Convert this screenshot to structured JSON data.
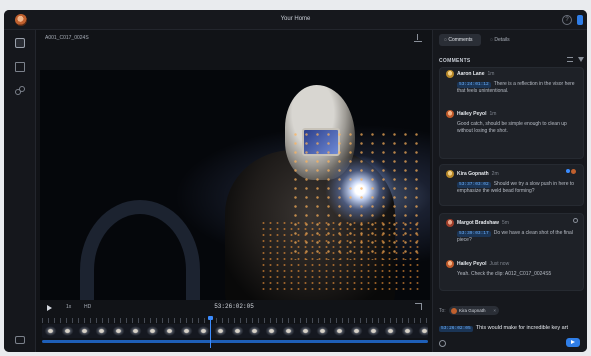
{
  "window": {
    "title": "Your Home"
  },
  "file": {
    "name": "A001_C017_0024S"
  },
  "player": {
    "speed": "1x",
    "quality": "HD",
    "timecode": "53:26:02:05"
  },
  "panel": {
    "tabs": [
      {
        "label": "Comments"
      },
      {
        "label": "Details"
      }
    ],
    "section_title": "COMMENTS",
    "comments": [
      {
        "name": "Aaron Lane",
        "time": "1m",
        "timecode": "53:24:01:12",
        "text": "There is a reflection in the visor here that feels unintentional."
      },
      {
        "name": "Hailey Peyol",
        "time": "1m",
        "timecode": "",
        "text": "Good catch, should be simple enough to clean up without losing the shot."
      },
      {
        "name": "Kira Gopnath",
        "time": "2m",
        "timecode": "53:37:03:02",
        "text": "Should we try a slow push in here to emphasize the weld bead forming?"
      },
      {
        "name": "Margot Bradshaw",
        "time": "5m",
        "timecode": "53:39:03:17",
        "text": "Do we have a clean shot of the final piece?"
      },
      {
        "name": "Hailey Peyol",
        "time": "Just now",
        "timecode": "",
        "text": "Yeah. Check the clip: A012_C017_0024S5"
      }
    ],
    "to_label": "To:",
    "to_recipient": "Kira Gopnath",
    "compose": {
      "timecode": "53:26:02:05",
      "text": "This would make for incredible key art"
    }
  }
}
